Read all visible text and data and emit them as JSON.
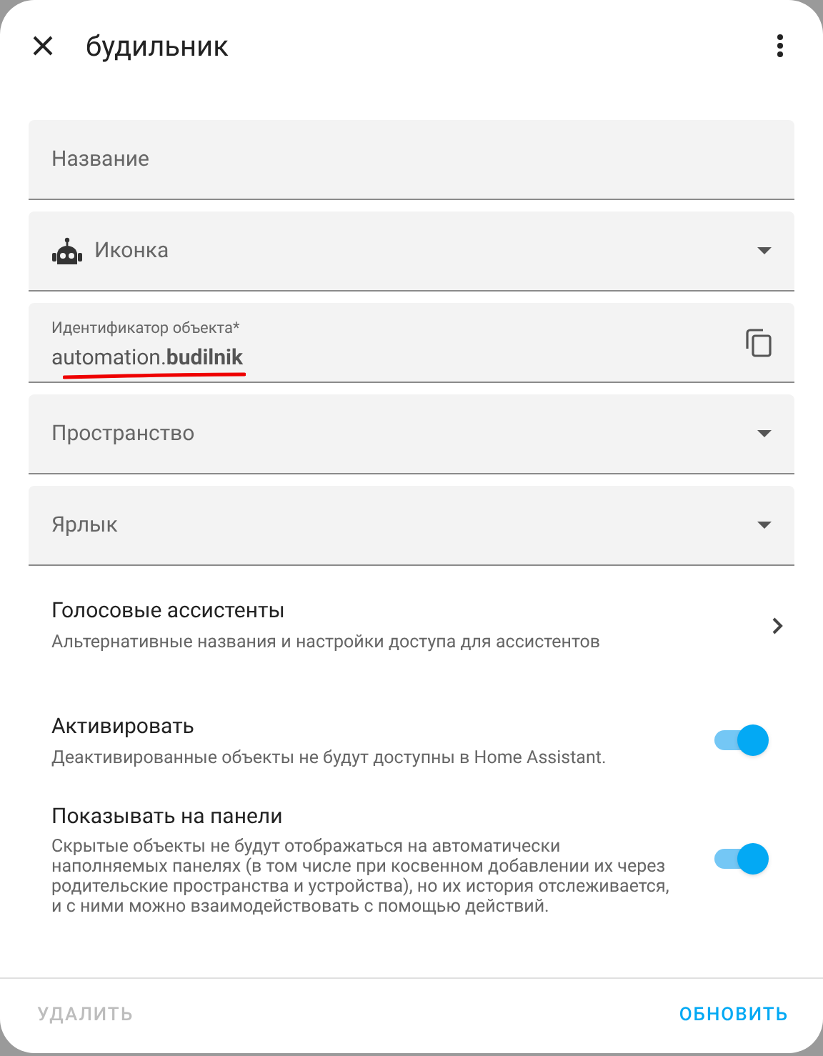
{
  "dialog": {
    "title": "будильник"
  },
  "fields": [
    {
      "kind": "text",
      "label": "Название"
    },
    {
      "kind": "icon-select",
      "label": "Иконка"
    },
    {
      "kind": "entity-id",
      "label": "Идентификатор объекта*",
      "value": "automation.**budilnik**"
    },
    {
      "kind": "select",
      "label": "Пространство"
    },
    {
      "kind": "select",
      "label": "Ярлык"
    }
  ],
  "voice_assistants": {
    "title": "Голосовые ассистенты",
    "description": "Альтернативные названия и настройки доступа для ассистентов"
  },
  "toggles": [
    {
      "title": "Активировать",
      "description": "Деактивированные объекты не будут доступны в Home Assistant.",
      "on": true
    },
    {
      "title": "Показывать на панели",
      "description": "Скрытые объекты не будут отображаться на автоматически наполняемых панелях (в том числе при косвенном добавлении их через родительские пространства и устройства), но их история отслеживается, и с ними можно взаимодействовать с помощью действий.",
      "on": true
    }
  ],
  "buttons": [
    {
      "label": "УДАЛИТЬ",
      "disabled": true
    },
    {
      "label": "ОБНОВИТЬ",
      "disabled": false
    }
  ]
}
